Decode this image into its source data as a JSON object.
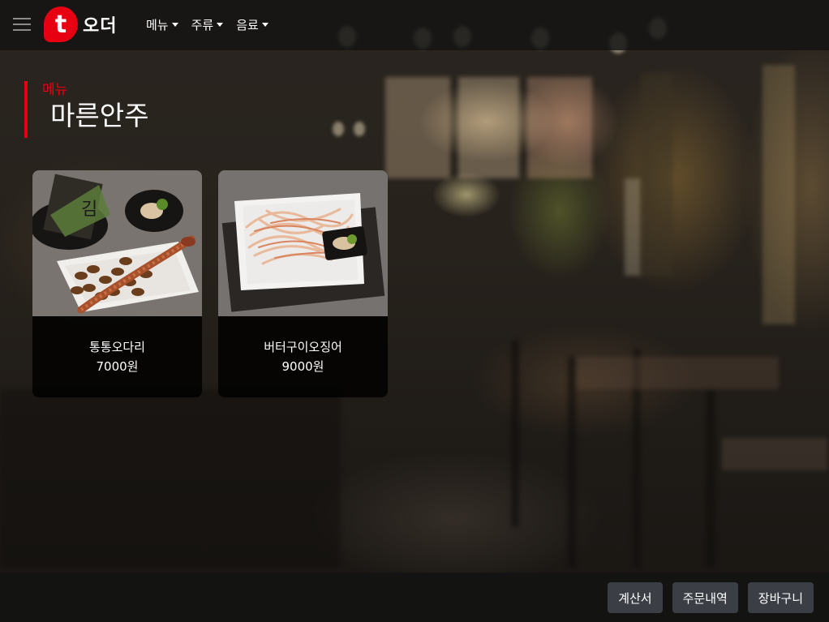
{
  "navbar": {
    "logo_letter": "t",
    "logo_text": "오더",
    "menu": [
      {
        "label": "메뉴"
      },
      {
        "label": "주류"
      },
      {
        "label": "음료"
      }
    ]
  },
  "section": {
    "eyebrow": "메뉴",
    "title": "마른안주"
  },
  "products": [
    {
      "name": "통통오다리",
      "price": "7000원"
    },
    {
      "name": "버터구이오징어",
      "price": "9000원"
    }
  ],
  "footer": {
    "buttons": [
      {
        "label": "계산서"
      },
      {
        "label": "주문내역"
      },
      {
        "label": "장바구니"
      }
    ]
  },
  "colors": {
    "accent": "#e60012",
    "button_bg": "#3b3f45"
  },
  "icons": {
    "menu": "hamburger-icon",
    "dropdown": "caret-down-icon"
  }
}
